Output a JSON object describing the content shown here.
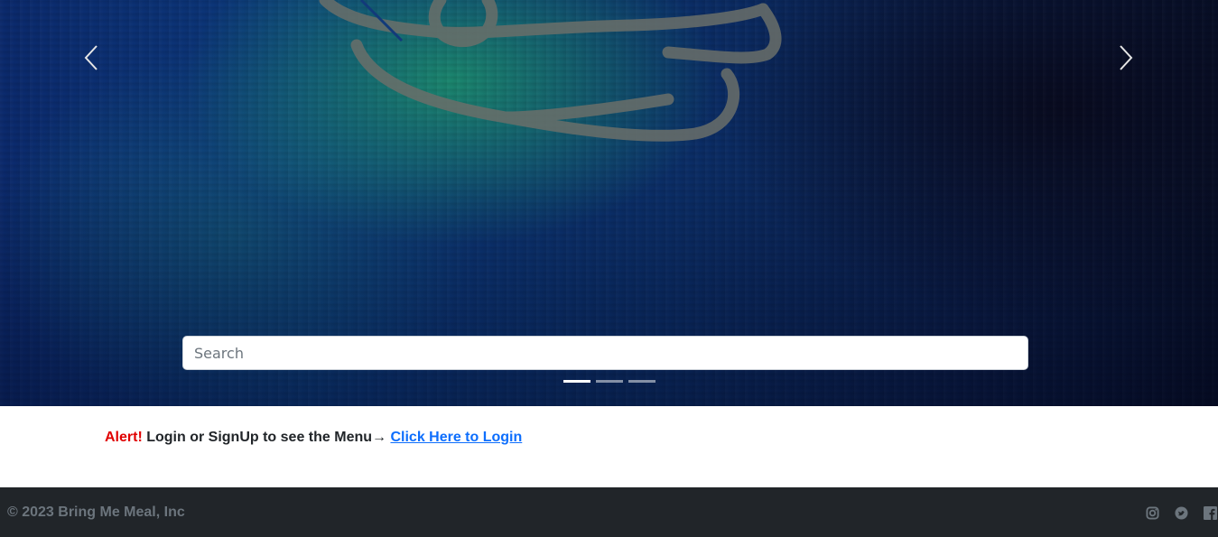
{
  "hero": {
    "search": {
      "placeholder": "Search",
      "value": ""
    },
    "carousel": {
      "prev_icon": "chevron-left-icon",
      "next_icon": "chevron-right-icon",
      "slide_count": 3,
      "active_slide": 1
    }
  },
  "alert": {
    "label": "Alert!",
    "message": "Login or SignUp to see the Menu→",
    "link_text": "Click Here to Login"
  },
  "footer": {
    "copyright": "© 2023 Bring Me Meal, Inc",
    "social": [
      "instagram-icon",
      "twitter-icon",
      "facebook-icon"
    ]
  },
  "colors": {
    "alert_red": "#e00000",
    "link_blue": "#0d6efd",
    "footer_bg": "#212529",
    "footer_text": "#6c757d"
  }
}
